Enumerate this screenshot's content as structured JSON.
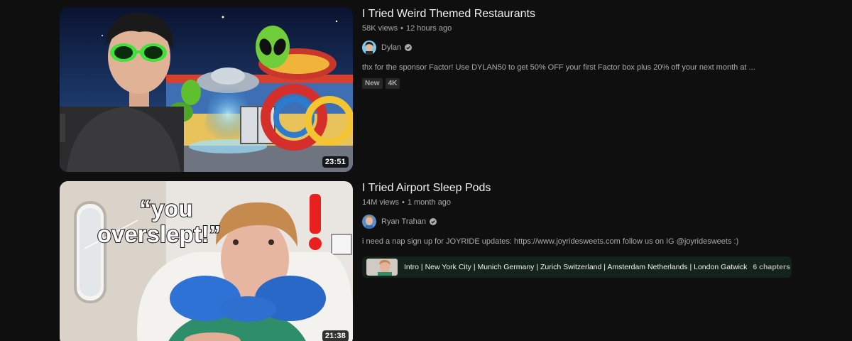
{
  "videos": [
    {
      "title": "I Tried Weird Themed Restaurants",
      "views": "58K views",
      "age": "12 hours ago",
      "channel": "Dylan",
      "description": "thx for the sponsor Factor! Use DYLAN50 to get 50% OFF your first Factor box plus 20% off your next month at ...",
      "duration": "23:51",
      "badges": [
        "New",
        "4K"
      ],
      "icons": {
        "verified": "verified-check-icon"
      }
    },
    {
      "title": "I Tried Airport Sleep Pods",
      "views": "14M views",
      "age": "1 month ago",
      "channel": "Ryan Trahan",
      "description": "i need a nap sign up for JOYRIDE updates: https://www.joyridesweets.com follow us on IG @joyridesweets :)",
      "duration": "21:38",
      "thumbnail_text": "“you overslept!”",
      "chapters": {
        "list": "Intro | New York City | Munich Germany | Zurich Switzerland | Amsterdam Netherlands | London Gatwick",
        "count": "6 chapters"
      },
      "icons": {
        "verified": "verified-check-icon",
        "expand": "chevron-down-icon"
      }
    }
  ],
  "colors": {
    "background": "#0f0f0f",
    "title_text": "#f1f1f1",
    "secondary_text": "#aaaaaa",
    "badge_bg": "#272727",
    "chapters_bg": "#13231c"
  }
}
